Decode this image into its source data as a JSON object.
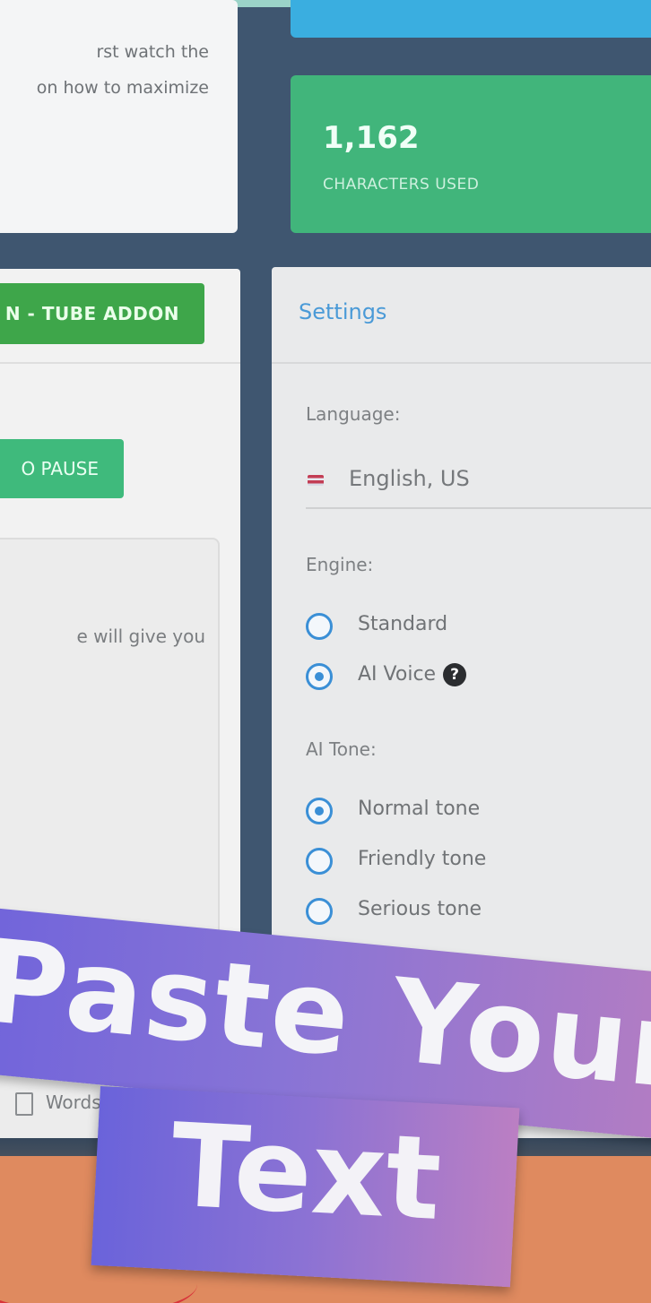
{
  "intro": {
    "line1": "rst watch the",
    "line2": "on how to maximize"
  },
  "stats": {
    "characters_value": "1,162",
    "characters_label": "CHARACTERS USED"
  },
  "left_panel": {
    "addon_button": "N - TUBE ADDON",
    "pause_button": "O PAUSE",
    "text_snippet": "e will give you",
    "words_label": "Words c"
  },
  "settings": {
    "title": "Settings",
    "language_label": "Language:",
    "language_value": "English, US",
    "engine_label": "Engine:",
    "engine_options": [
      {
        "label": "Standard",
        "selected": false
      },
      {
        "label": "AI Voice",
        "selected": true
      }
    ],
    "tone_label": "AI Tone:",
    "tone_options": [
      {
        "label": "Normal tone",
        "selected": true
      },
      {
        "label": "Friendly tone",
        "selected": false
      },
      {
        "label": "Serious tone",
        "selected": false
      }
    ],
    "help_glyph": "?"
  },
  "banner": {
    "line1": "Paste Your",
    "line2": "Text"
  },
  "colors": {
    "background": "#3f5670",
    "green_stat": "#41b57b",
    "blue_stat": "#3aaee0",
    "addon_green": "#3ea64a",
    "settings_blue": "#4a9ad7",
    "radio_blue": "#3a8fd6",
    "banner_start": "#6f63db",
    "banner_end": "#b57dc2",
    "ground": "#df8a5f"
  }
}
